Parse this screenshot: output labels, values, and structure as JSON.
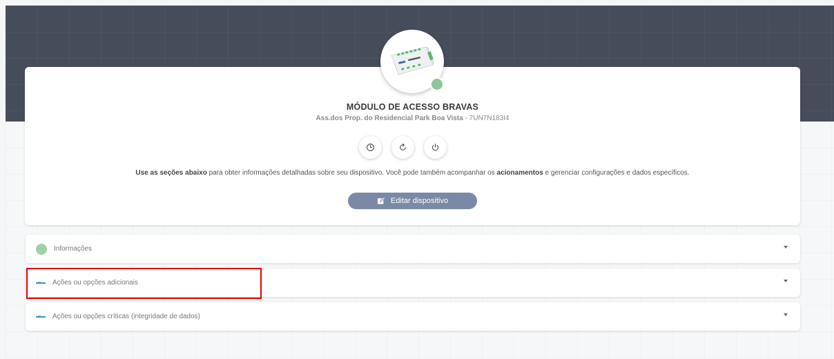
{
  "device": {
    "title": "MÓDULO DE ACESSO BRAVAS",
    "owner": "Ass.dos Prop. do Residencial Park Boa Vista",
    "id_separator": " - ",
    "serial": "7UN7N183I4",
    "status_color": "#8fc79a"
  },
  "actions": [
    {
      "icon": "clock-icon"
    },
    {
      "icon": "refresh-icon"
    },
    {
      "icon": "power-icon"
    }
  ],
  "info": {
    "bold_intro": "Use as seções abaixo",
    "text_1": " para obter informações detalhadas sobre seu dispositivo. Você pode também acompanhar os ",
    "bold_mid": "acionamentos",
    "text_2": " e gerenciar configurações e dados específicos."
  },
  "edit_button": {
    "label": "Editar dispositivo",
    "icon": "edit-icon"
  },
  "sections": [
    {
      "label": "Informações",
      "icon": "status-dot-icon"
    },
    {
      "label": "Ações ou opções adicionais",
      "icon": "brand-mini-icon"
    },
    {
      "label": "Ações ou opções críticas (integridade de dados)",
      "icon": "brand-mini-icon"
    }
  ],
  "colors": {
    "header_bg": "#464d5a",
    "primary_button": "#7a8aa6",
    "highlight": "#e00000"
  }
}
